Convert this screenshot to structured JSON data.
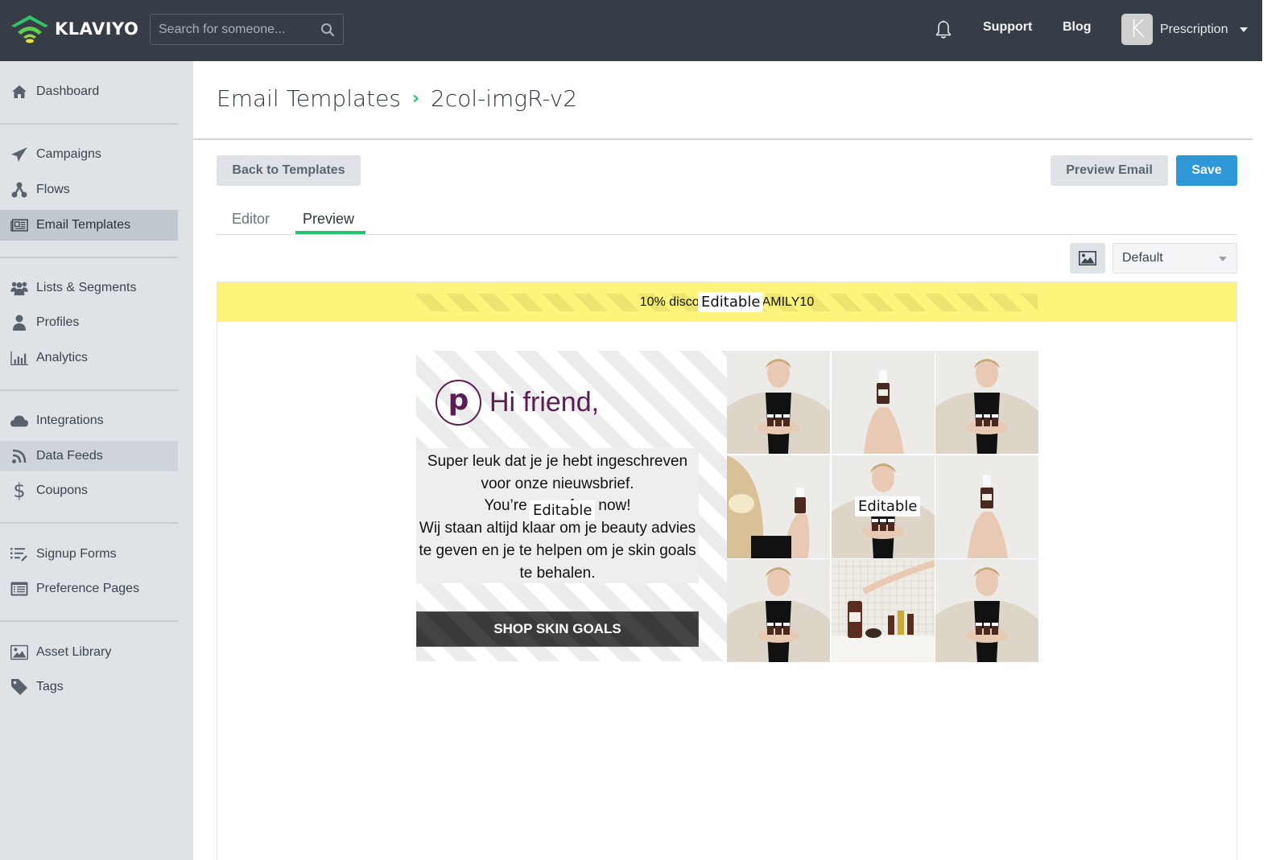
{
  "topbar": {
    "brand": "KLAVIYO",
    "search_placeholder": "Search for someone...",
    "links": {
      "support": "Support",
      "blog": "Blog"
    },
    "account": {
      "avatar_letter": "K",
      "name": "Prescription"
    }
  },
  "sidebar": {
    "items": [
      {
        "label": "Dashboard",
        "icon": "home-icon"
      },
      {
        "label": "Campaigns",
        "icon": "paper-plane-icon"
      },
      {
        "label": "Flows",
        "icon": "flows-icon"
      },
      {
        "label": "Email Templates",
        "icon": "newspaper-icon",
        "active": true
      },
      {
        "label": "Lists & Segments",
        "icon": "users-icon"
      },
      {
        "label": "Profiles",
        "icon": "user-icon"
      },
      {
        "label": "Analytics",
        "icon": "bar-chart-icon"
      },
      {
        "label": "Integrations",
        "icon": "cloud-icon"
      },
      {
        "label": "Data Feeds",
        "icon": "rss-icon",
        "hover": true
      },
      {
        "label": "Coupons",
        "icon": "dollar-icon"
      },
      {
        "label": "Signup Forms",
        "icon": "list-edit-icon"
      },
      {
        "label": "Preference Pages",
        "icon": "list-card-icon"
      },
      {
        "label": "Asset Library",
        "icon": "image-icon"
      },
      {
        "label": "Tags",
        "icon": "tag-icon"
      }
    ]
  },
  "header": {
    "breadcrumb_root": "Email Templates",
    "breadcrumb_separator": "›",
    "template_name": "2col-imgR-v2"
  },
  "actions": {
    "back": "Back to Templates",
    "preview_email": "Preview Email",
    "save": "Save"
  },
  "tabs": [
    {
      "label": "Editor",
      "active": false
    },
    {
      "label": "Preview",
      "active": true
    }
  ],
  "preview_controls": {
    "profile_select": "Default"
  },
  "email": {
    "announcement_visible": "10% disco",
    "announcement_visible_tail": "AMILY10",
    "editable_tag": "Editable",
    "greeting": "Hi friend,",
    "brand_logo_letter": "p",
    "body_lines": [
      "Super leuk dat je je hebt ingeschreven",
      "voor onze nieuwsbrief.",
      "You’re one of us now!",
      "Wij staan altijd klaar om je beauty advies",
      "te geven en je te helpen om je skin goals",
      "te behalen."
    ],
    "cta": "SHOP SKIN GOALS",
    "photo_grid_count": 9
  },
  "colors": {
    "topbar": "#373d46",
    "sidebar": "#dfe3e7",
    "accent_green": "#25c26e",
    "save_blue": "#2e98d6",
    "announcement_yellow": "#fdf57b",
    "brand_purple": "#5c1d55"
  }
}
